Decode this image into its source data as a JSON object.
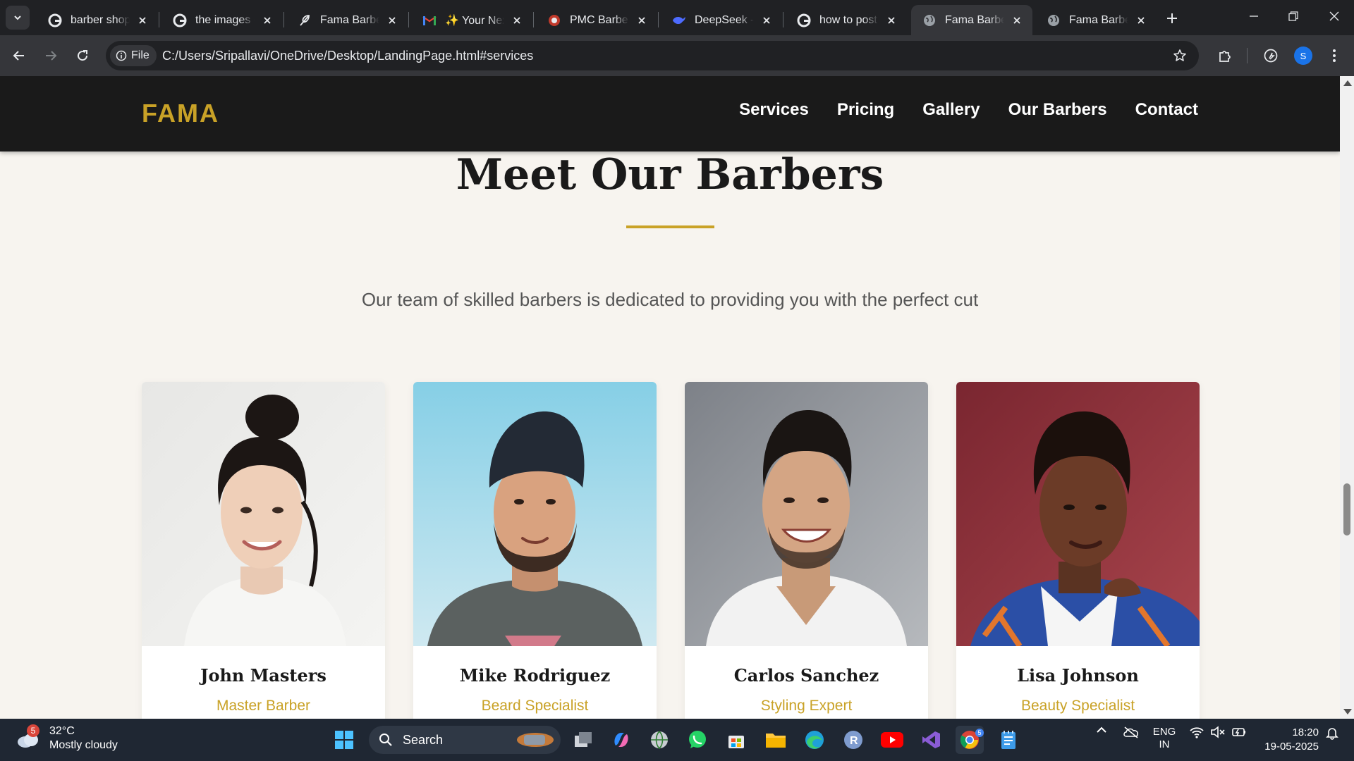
{
  "browser": {
    "tabs": [
      {
        "title": "barber shop p",
        "favicon": "google-icon",
        "active": false
      },
      {
        "title": "the images of",
        "favicon": "google-icon",
        "active": false
      },
      {
        "title": "Fama Barber S",
        "favicon": "feather-icon",
        "active": false
      },
      {
        "title": "✨ Your Next",
        "favicon": "gmail-icon",
        "active": false
      },
      {
        "title": "PMC Barbershi",
        "favicon": "pmc-icon",
        "active": false
      },
      {
        "title": "DeepSeek - In",
        "favicon": "deepseek-icon",
        "active": false
      },
      {
        "title": "how to post r",
        "favicon": "google-icon",
        "active": false
      },
      {
        "title": "Fama Barber",
        "favicon": "globe-icon",
        "active": true
      },
      {
        "title": "Fama Barber",
        "favicon": "globe-icon",
        "active": false
      }
    ],
    "chip_label": "File",
    "url": "C:/Users/Sripallavi/OneDrive/Desktop/LandingPage.html#services",
    "profile_initial": "S"
  },
  "site": {
    "logo": "FAMA",
    "nav": [
      "Services",
      "Pricing",
      "Gallery",
      "Our Barbers",
      "Contact"
    ],
    "section": {
      "title": "Meet Our Barbers",
      "subtitle": "Our team of skilled barbers is dedicated to providing you with the perfect cut"
    },
    "barbers": [
      {
        "name": "John Masters",
        "role": "Master Barber"
      },
      {
        "name": "Mike Rodriguez",
        "role": "Beard Specialist"
      },
      {
        "name": "Carlos Sanchez",
        "role": "Styling Expert"
      },
      {
        "name": "Lisa Johnson",
        "role": "Beauty Specialist"
      }
    ],
    "colors": {
      "accent": "#c9a227",
      "header_bg": "#1a1a1a",
      "page_bg": "#f7f4ef"
    }
  },
  "taskbar": {
    "weather": {
      "badge": "5",
      "temp": "32°C",
      "condition": "Mostly cloudy"
    },
    "search_label": "Search",
    "language": {
      "line1": "ENG",
      "line2": "IN"
    },
    "time": "18:20",
    "date": "19-05-2025",
    "chrome_badge": "5"
  }
}
